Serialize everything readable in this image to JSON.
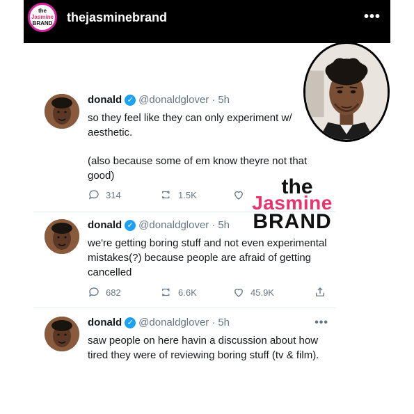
{
  "header": {
    "username": "thejasminebrand",
    "more": "•••",
    "logo_text": [
      "the",
      "Jasmine",
      "BRAND"
    ]
  },
  "watermark": {
    "the": "the",
    "jasmine": "Jasmine",
    "brand": "BRAND"
  },
  "tweets": [
    {
      "display_name": "donald",
      "handle": "@donaldglover",
      "dot": "·",
      "time": "5h",
      "paragraphs": [
        "so they feel like they can only experiment w/ aesthetic.",
        "(also because some of em know theyre not that good)"
      ],
      "replies": "314",
      "retweets": "1.5K",
      "likes": "",
      "more": ""
    },
    {
      "display_name": "donald",
      "handle": "@donaldglover",
      "dot": "·",
      "time": "5h",
      "paragraphs": [
        "we're getting boring stuff and not even experimental mistakes(?) because people are afraid of getting cancelled"
      ],
      "replies": "682",
      "retweets": "6.6K",
      "likes": "45.9K",
      "more": ""
    },
    {
      "display_name": "donald",
      "handle": "@donaldglover",
      "dot": "·",
      "time": "5h",
      "paragraphs": [
        "saw people on here havin a discussion about how tired they were of reviewing boring stuff (tv & film)."
      ],
      "more": "•••"
    }
  ],
  "colors": {
    "header_bg": "#000000",
    "verified": "#1da1f2",
    "muted": "#657786",
    "brand_pink": "#e8336d"
  }
}
